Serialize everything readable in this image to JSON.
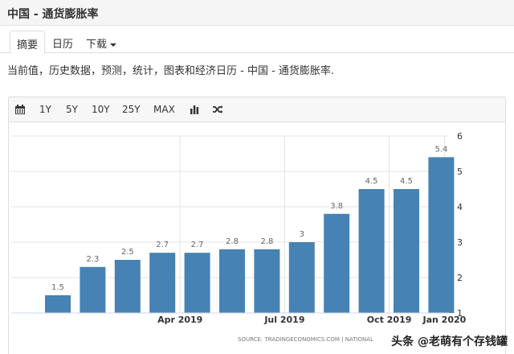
{
  "page_title": "中国 - 通货膨胀率",
  "tabs": [
    {
      "label": "摘要"
    },
    {
      "label": "日历"
    },
    {
      "label": "下载"
    }
  ],
  "description": "当前值，历史数据，预测，统计，图表和经济日历 - 中国 - 通货膨胀率.",
  "toolbar": {
    "ranges": [
      "1Y",
      "5Y",
      "10Y",
      "25Y",
      "MAX"
    ],
    "icons": [
      "calendar-icon",
      "bar-chart-icon",
      "shuffle-icon"
    ]
  },
  "chart_data": {
    "type": "bar",
    "categories": [
      "2019-01",
      "2019-02",
      "2019-03",
      "2019-04",
      "2019-05",
      "2019-06",
      "2019-07",
      "2019-08",
      "2019-09",
      "2019-10",
      "2019-11",
      "2019-12",
      "2020-01"
    ],
    "values": [
      1.5,
      2.3,
      2.5,
      2.7,
      2.7,
      2.8,
      2.8,
      3,
      3.8,
      4.5,
      4.5,
      5.4,
      null
    ],
    "bar_labels": [
      "1.5",
      "2.3",
      "2.5",
      "2.7",
      "2.7",
      "2.8",
      "2.8",
      "3",
      "3.8",
      "4.5",
      "4.5",
      "5.4"
    ],
    "x_tick_labels": [
      "Apr 2019",
      "Jul 2019",
      "Oct 2019",
      "Jan 2020"
    ],
    "y_ticks": [
      1,
      2,
      3,
      4,
      5,
      6
    ],
    "ylim": [
      1,
      6
    ],
    "y_axis_side": "right",
    "grid": true,
    "bar_color": "#4682b4",
    "source": "SOURCE: TRADINGECONOMICS.COM | NATIONAL"
  },
  "watermark": "头条 @老萌有个存钱罐"
}
